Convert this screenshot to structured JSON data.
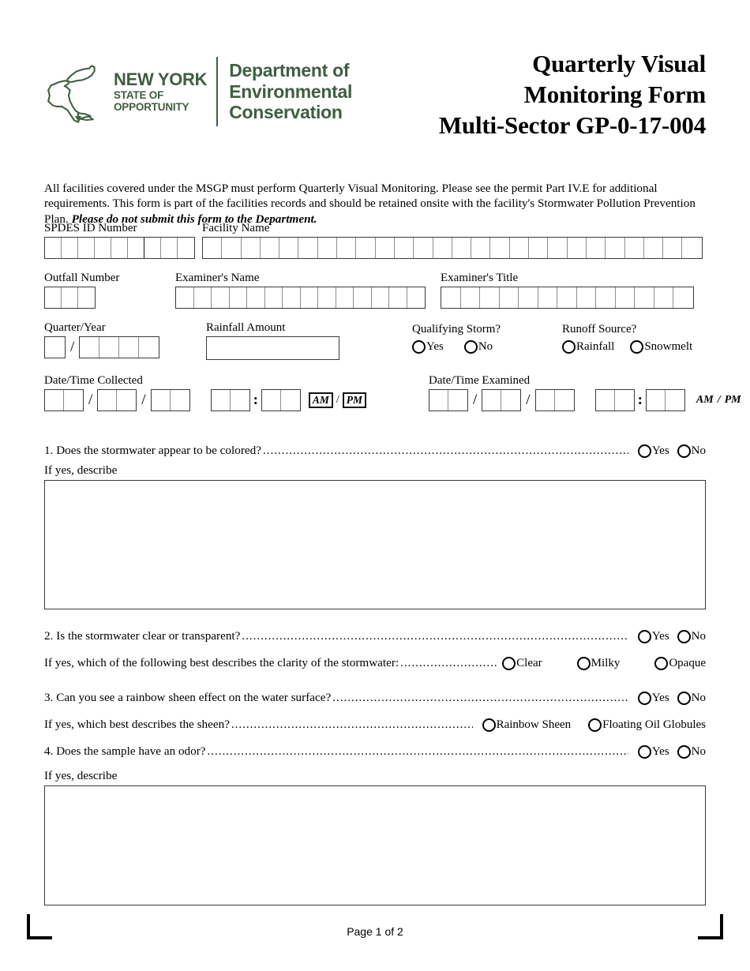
{
  "logo": {
    "state_line1": "NEW YORK",
    "state_line2": "STATE OF",
    "state_line3": "OPPORTUNITY",
    "dept_line1": "Department of",
    "dept_line2": "Environmental",
    "dept_line3": "Conservation",
    "color": "#3f5e41"
  },
  "title": {
    "line1": "Quarterly Visual",
    "line2": "Monitoring Form",
    "line3": "Multi-Sector GP-0-17-004"
  },
  "intro": {
    "text": "All facilities covered under the MSGP must perform Quarterly Visual Monitoring. Please see the permit Part IV.E for additional requirements. This form is part of the facilities records and should be retained onsite with the facility's Stormwater Pollution Prevention Plan. ",
    "bold_text": "Please do not submit this form to the Department."
  },
  "fields": {
    "spdes_id": {
      "label": "SPDES ID Number",
      "cells": 9,
      "heavy_after": 6,
      "value": ""
    },
    "facility_name": {
      "label": "Facility Name",
      "cells": 26,
      "value": ""
    },
    "outfall_number": {
      "label": "Outfall Number",
      "cells": 3,
      "value": ""
    },
    "examiners_name": {
      "label": "Examiner's Name",
      "cells": 14,
      "value": ""
    },
    "examiners_title": {
      "label": "Examiner's Title",
      "cells": 13,
      "value": ""
    },
    "quarter_year": {
      "label": "Quarter/Year",
      "quarter_cells": 1,
      "year_cells": 4,
      "separator": "/",
      "value": ""
    },
    "rainfall_amount": {
      "label": "Rainfall Amount",
      "value": ""
    },
    "qualifying_storm": {
      "label": "Qualifying Storm?",
      "options": [
        "Yes",
        "No"
      ],
      "selected": ""
    },
    "runoff_source": {
      "label": "Runoff Source?",
      "options": [
        "Rainfall",
        "Snowmelt"
      ],
      "selected": ""
    },
    "date_time_collected": {
      "label": "Date/Time Collected",
      "month_cells": 2,
      "day_cells": 2,
      "year_cells": 2,
      "hour_cells": 2,
      "minute_cells": 2,
      "separator": "/",
      "time_separator": ":",
      "am_label": "AM",
      "pm_label": "PM",
      "ampm_separator": "/",
      "ampm_boxed": true,
      "value": ""
    },
    "date_time_examined": {
      "label": "Date/Time Examined",
      "month_cells": 2,
      "day_cells": 2,
      "year_cells": 2,
      "hour_cells": 2,
      "minute_cells": 2,
      "separator": "/",
      "time_separator": ":",
      "am_label": "AM",
      "pm_label": "PM",
      "ampm_separator": "/",
      "ampm_boxed": false,
      "value": ""
    }
  },
  "questions": [
    {
      "number": "1.",
      "text": "1. Does the stormwater appear to be colored?",
      "options": [
        "Yes",
        "No"
      ],
      "selected": "",
      "describe_label": "If yes, describe",
      "describe_value": ""
    },
    {
      "number": "2.",
      "text": "2. Is the stormwater clear or transparent?",
      "options": [
        "Yes",
        "No"
      ],
      "selected": "",
      "followup_text": "If yes, which of the following best describes the clarity of the stormwater:",
      "followup_options": [
        "Clear",
        "Milky",
        "Opaque"
      ],
      "followup_selected": ""
    },
    {
      "number": "3.",
      "text": "3. Can you see a rainbow sheen effect on the water surface?",
      "options": [
        "Yes",
        "No"
      ],
      "selected": "",
      "followup_text": "If yes, which best describes the sheen?",
      "followup_options": [
        "Rainbow Sheen",
        "Floating Oil Globules"
      ],
      "followup_selected": ""
    },
    {
      "number": "4.",
      "text": "4. Does the sample have an odor?",
      "options": [
        "Yes",
        "No"
      ],
      "selected": "",
      "describe_label": "If yes, describe",
      "describe_value": ""
    }
  ],
  "footer": {
    "page_label": "Page 1 of 2"
  }
}
